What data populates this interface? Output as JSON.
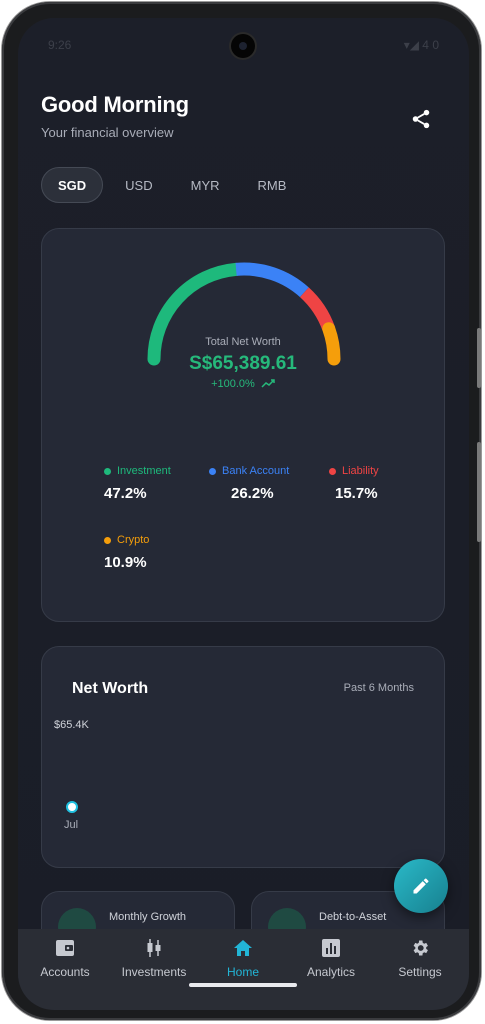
{
  "status": {
    "time": "9:26",
    "right": "▾◢ 4 0"
  },
  "header": {
    "greeting": "Good Morning",
    "subtitle": "Your financial overview"
  },
  "currencies": [
    {
      "label": "SGD",
      "active": true
    },
    {
      "label": "USD",
      "active": false
    },
    {
      "label": "MYR",
      "active": false
    },
    {
      "label": "RMB",
      "active": false
    }
  ],
  "overview": {
    "total_label": "Total Net Worth",
    "total_value": "S$65,389.61",
    "change": "+100.0%",
    "allocations": [
      {
        "label": "Investment",
        "value": "47.2%",
        "pct": 47.2,
        "color": "#1eb97c"
      },
      {
        "label": "Bank Account",
        "value": "26.2%",
        "pct": 26.2,
        "color": "#3b82f6"
      },
      {
        "label": "Liability",
        "value": "15.7%",
        "pct": 15.7,
        "color": "#ef4444"
      },
      {
        "label": "Crypto",
        "value": "10.9%",
        "pct": 10.9,
        "color": "#f59e0b"
      }
    ]
  },
  "networth_chart": {
    "title": "Net Worth",
    "range": "Past 6 Months",
    "y_label": "$65.4K",
    "x_label": "Jul"
  },
  "mini_cards": [
    {
      "label": "Monthly Growth"
    },
    {
      "label": "Debt-to-Asset"
    }
  ],
  "nav": [
    {
      "label": "Accounts",
      "active": false
    },
    {
      "label": "Investments",
      "active": false
    },
    {
      "label": "Home",
      "active": true
    },
    {
      "label": "Analytics",
      "active": false
    },
    {
      "label": "Settings",
      "active": false
    }
  ],
  "colors": {
    "accent": "#22b5d6",
    "positive": "#26b97b"
  }
}
